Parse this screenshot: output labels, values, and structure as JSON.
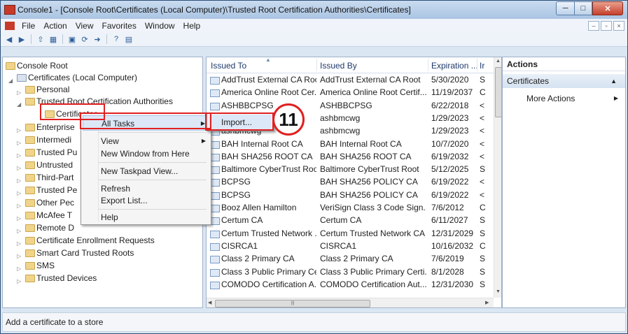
{
  "window": {
    "title": "Console1 - [Console Root\\Certificates (Local Computer)\\Trusted Root Certification Authorities\\Certificates]"
  },
  "menubar": [
    "File",
    "Action",
    "View",
    "Favorites",
    "Window",
    "Help"
  ],
  "tree": [
    {
      "label": "Console Root"
    },
    {
      "label": "Certificates (Local Computer)"
    },
    {
      "label": "Personal"
    },
    {
      "label": "Trusted Root Certification Authorities"
    },
    {
      "label": "Certificates"
    },
    {
      "label": "Enterprise"
    },
    {
      "label": "Intermedi"
    },
    {
      "label": "Trusted Pu"
    },
    {
      "label": "Untrusted"
    },
    {
      "label": "Third-Part"
    },
    {
      "label": "Trusted Pe"
    },
    {
      "label": "Other Pec"
    },
    {
      "label": "McAfee T"
    },
    {
      "label": "Remote D"
    },
    {
      "label": "Certificate Enrollment Requests"
    },
    {
      "label": "Smart Card Trusted Roots"
    },
    {
      "label": "SMS"
    },
    {
      "label": "Trusted Devices"
    }
  ],
  "columns": {
    "issued_to": "Issued To",
    "issued_by": "Issued By",
    "expiration": "Expiration ...",
    "intended": "Ir"
  },
  "rows": [
    {
      "to": "AddTrust External CA Root",
      "by": "AddTrust External CA Root",
      "exp": "5/30/2020",
      "i": "S"
    },
    {
      "to": "America Online Root Cer...",
      "by": "America Online Root Certif...",
      "exp": "11/19/2037",
      "i": "C"
    },
    {
      "to": "ASHBBCPSG",
      "by": "ASHBBCPSG",
      "exp": "6/22/2018",
      "i": "<"
    },
    {
      "to": "ashbmcwg",
      "by": "ashbmcwg",
      "exp": "1/29/2023",
      "i": "<"
    },
    {
      "to": "ashbmcwg",
      "by": "ashbmcwg",
      "exp": "1/29/2023",
      "i": "<"
    },
    {
      "to": "BAH Internal Root CA",
      "by": "BAH Internal Root CA",
      "exp": "10/7/2020",
      "i": "<"
    },
    {
      "to": "BAH SHA256 ROOT CA",
      "by": "BAH SHA256 ROOT CA",
      "exp": "6/19/2032",
      "i": "<"
    },
    {
      "to": "Baltimore CyberTrust Root",
      "by": "Baltimore CyberTrust Root",
      "exp": "5/12/2025",
      "i": "S"
    },
    {
      "to": "BCPSG",
      "by": "BAH SHA256 POLICY CA",
      "exp": "6/19/2022",
      "i": "<"
    },
    {
      "to": "BCPSG",
      "by": "BAH SHA256 POLICY CA",
      "exp": "6/19/2022",
      "i": "<"
    },
    {
      "to": "Booz Allen Hamilton",
      "by": "VeriSign Class 3 Code Sign...",
      "exp": "7/6/2012",
      "i": "C"
    },
    {
      "to": "Certum CA",
      "by": "Certum CA",
      "exp": "6/11/2027",
      "i": "S"
    },
    {
      "to": "Certum Trusted Network ...",
      "by": "Certum Trusted Network CA",
      "exp": "12/31/2029",
      "i": "S"
    },
    {
      "to": "CISRCA1",
      "by": "CISRCA1",
      "exp": "10/16/2032",
      "i": "C"
    },
    {
      "to": "Class 2 Primary CA",
      "by": "Class 2 Primary CA",
      "exp": "7/6/2019",
      "i": "S"
    },
    {
      "to": "Class 3 Public Primary Ce...",
      "by": "Class 3 Public Primary Certi...",
      "exp": "8/1/2028",
      "i": "S"
    },
    {
      "to": "COMODO Certification A...",
      "by": "COMODO Certification Aut...",
      "exp": "12/31/2030",
      "i": "S"
    }
  ],
  "actions": {
    "header": "Actions",
    "section": "Certificates",
    "more": "More Actions"
  },
  "context_menu": {
    "all_tasks": "All Tasks",
    "view": "View",
    "new_window": "New Window from Here",
    "new_taskpad": "New Taskpad View...",
    "refresh": "Refresh",
    "export": "Export List...",
    "help": "Help"
  },
  "submenu": {
    "import": "Import..."
  },
  "callout": "11",
  "status": "Add a certificate to a store",
  "colors": {
    "highlight": "#e02020",
    "titlebar": "#aac4e2"
  }
}
